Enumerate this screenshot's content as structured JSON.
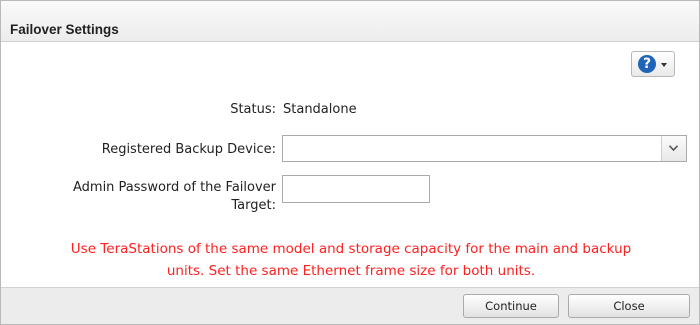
{
  "window": {
    "title": "Failover Settings"
  },
  "help": {
    "icon": "help-icon",
    "glyph": "?"
  },
  "form": {
    "status_label": "Status:",
    "status_value": "Standalone",
    "device_label": "Registered Backup Device:",
    "device_value": "",
    "password_label_line1": "Admin Password of the Failover",
    "password_label_line2": "Target:",
    "password_value": ""
  },
  "warning": {
    "line1": "Use TeraStations of the same model and storage capacity for the main and backup",
    "line2": "units. Set the same Ethernet frame size for both units.",
    "color": "#ff2020"
  },
  "footer": {
    "continue_label": "Continue",
    "close_label": "Close"
  }
}
